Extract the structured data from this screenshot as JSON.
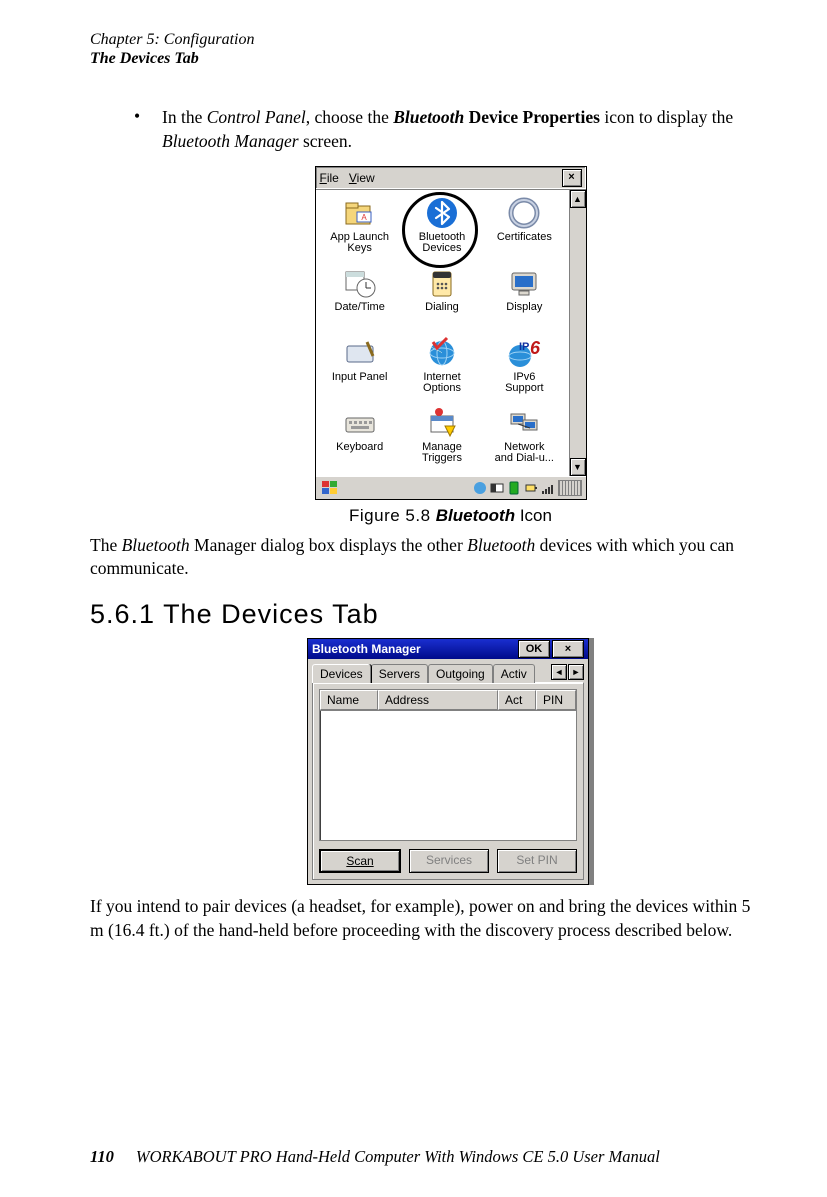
{
  "header": {
    "chapter": "Chapter 5: Configuration",
    "section": "The Devices Tab"
  },
  "bullet": {
    "mark": "•",
    "pre": "In the ",
    "em1": "Control Panel",
    "mid": ", choose the ",
    "bold_em": "Bluetooth",
    "bold_tail": " Device Properties",
    "post1": " icon to display the ",
    "em2": "Bluetooth Manager",
    "post2": " screen."
  },
  "control_panel": {
    "menu_file": "File",
    "menu_view": "View",
    "close": "×",
    "scroll_up": "▲",
    "scroll_down": "▼",
    "items": [
      {
        "line1": "App Launch",
        "line2": "Keys"
      },
      {
        "line1": "Bluetooth",
        "line2": "Devices"
      },
      {
        "line1": "Certificates",
        "line2": ""
      },
      {
        "line1": "Date/Time",
        "line2": ""
      },
      {
        "line1": "Dialing",
        "line2": ""
      },
      {
        "line1": "Display",
        "line2": ""
      },
      {
        "line1": "Input Panel",
        "line2": ""
      },
      {
        "line1": "Internet",
        "line2": "Options"
      },
      {
        "line1": "IPv6",
        "line2": "Support"
      },
      {
        "line1": "Keyboard",
        "line2": ""
      },
      {
        "line1": "Manage",
        "line2": "Triggers"
      },
      {
        "line1": "Network",
        "line2": "and Dial-u..."
      }
    ]
  },
  "fig58": {
    "label": "Figure 5.8 ",
    "name": "Bluetooth",
    "tail": " Icon"
  },
  "para1": {
    "p1": "The ",
    "em1": "Bluetooth",
    "p2": " Manager dialog box displays the other ",
    "em2": "Bluetooth",
    "p3": " devices with which you can communicate."
  },
  "heading": "5.6.1  The Devices Tab",
  "bm": {
    "title": "Bluetooth Manager",
    "ok": "OK",
    "close": "×",
    "tabs": {
      "devices": "Devices",
      "servers": "Servers",
      "outgoing": "Outgoing",
      "active": "Activ"
    },
    "nav_left": "◄",
    "nav_right": "►",
    "cols": {
      "name": "Name",
      "address": "Address",
      "act": "Act",
      "pin": "PIN"
    },
    "btn_scan": "Scan",
    "btn_services": "Services",
    "btn_setpin": "Set PIN"
  },
  "para2": "If you intend to pair devices (a headset, for example), power on and bring the devices within 5 m (16.4 ft.) of the hand-held before proceeding with the discovery process described below.",
  "footer": {
    "page": "110",
    "title": "WORKABOUT PRO Hand-Held Computer With Windows CE 5.0 User Manual"
  },
  "colors": {
    "bt_blue": "#1a6fd6",
    "title_blue": "#000a8a"
  }
}
